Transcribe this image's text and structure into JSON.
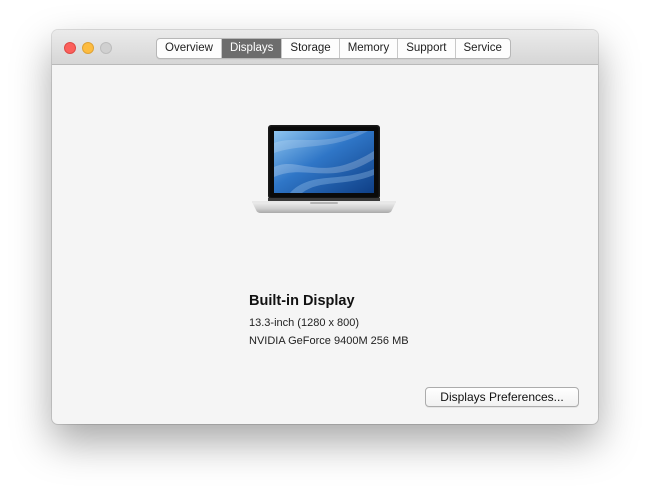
{
  "window": {
    "controls": {
      "close": "close-icon",
      "minimize": "minimize-icon",
      "zoom": "zoom-icon"
    }
  },
  "tabs": [
    {
      "label": "Overview",
      "active": false
    },
    {
      "label": "Displays",
      "active": true
    },
    {
      "label": "Storage",
      "active": false
    },
    {
      "label": "Memory",
      "active": false
    },
    {
      "label": "Support",
      "active": false
    },
    {
      "label": "Service",
      "active": false
    }
  ],
  "display": {
    "icon": "macbook-laptop-icon",
    "title": "Built-in Display",
    "size": "13.3-inch (1280 x 800)",
    "graphics": "NVIDIA GeForce 9400M 256 MB"
  },
  "actions": {
    "preferences_label": "Displays Preferences..."
  },
  "colors": {
    "active_tab": "#6d6d6d",
    "close": "#fc605c",
    "minimize": "#fdbc40",
    "zoom_inactive": "#d0d0d0"
  }
}
